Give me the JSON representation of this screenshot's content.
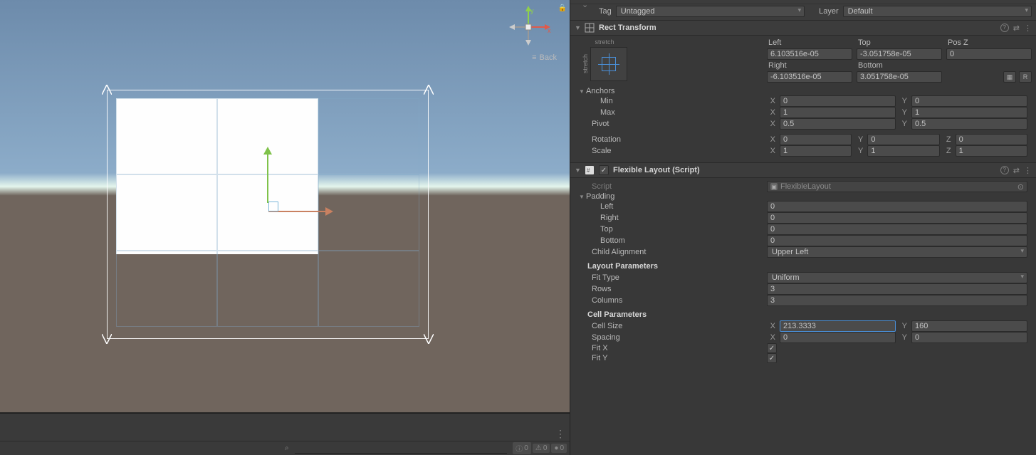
{
  "header": {
    "tag_label": "Tag",
    "tag_value": "Untagged",
    "layer_label": "Layer",
    "layer_value": "Default"
  },
  "scene": {
    "back_label": "Back",
    "axis_x": "x",
    "axis_y": "y",
    "status_info_count": "0",
    "status_warn_count": "0",
    "status_err_count": "0"
  },
  "rect_transform": {
    "title": "Rect Transform",
    "stretch_h": "stretch",
    "stretch_v": "stretch",
    "left_label": "Left",
    "left_value": "6.103516e-05",
    "top_label": "Top",
    "top_value": "-3.051758e-05",
    "posz_label": "Pos Z",
    "posz_value": "0",
    "right_label": "Right",
    "right_value": "-6.103516e-05",
    "bottom_label": "Bottom",
    "bottom_value": "3.051758e-05",
    "btn_r": "R",
    "anchors_label": "Anchors",
    "min_label": "Min",
    "min_x": "0",
    "min_y": "0",
    "max_label": "Max",
    "max_x": "1",
    "max_y": "1",
    "pivot_label": "Pivot",
    "pivot_x": "0.5",
    "pivot_y": "0.5",
    "rotation_label": "Rotation",
    "rot_x": "0",
    "rot_y": "0",
    "rot_z": "0",
    "scale_label": "Scale",
    "scale_x": "1",
    "scale_y": "1",
    "scale_z": "1",
    "ax_x": "X",
    "ax_y": "Y",
    "ax_z": "Z"
  },
  "flexible_layout": {
    "title": "Flexible Layout (Script)",
    "script_label": "Script",
    "script_value": "FlexibleLayout",
    "padding_label": "Padding",
    "pad_left_label": "Left",
    "pad_left": "0",
    "pad_right_label": "Right",
    "pad_right": "0",
    "pad_top_label": "Top",
    "pad_top": "0",
    "pad_bottom_label": "Bottom",
    "pad_bottom": "0",
    "child_align_label": "Child Alignment",
    "child_align_value": "Upper Left",
    "layout_params_heading": "Layout Parameters",
    "fit_type_label": "Fit Type",
    "fit_type_value": "Uniform",
    "rows_label": "Rows",
    "rows_value": "3",
    "columns_label": "Columns",
    "columns_value": "3",
    "cell_params_heading": "Cell Parameters",
    "cell_size_label": "Cell Size",
    "cell_size_x": "213.3333",
    "cell_size_y": "160",
    "spacing_label": "Spacing",
    "spacing_x": "0",
    "spacing_y": "0",
    "fit_x_label": "Fit X",
    "fit_y_label": "Fit Y",
    "ax_x": "X",
    "ax_y": "Y"
  }
}
